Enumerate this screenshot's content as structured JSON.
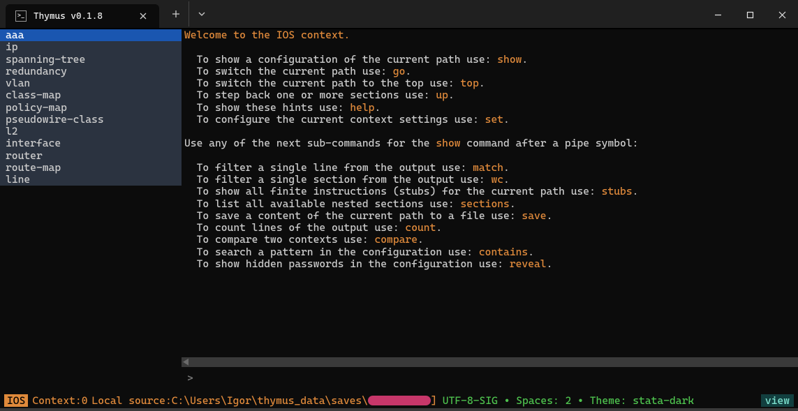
{
  "window": {
    "tab_title": "Thymus v0.1.8"
  },
  "sidebar": {
    "items": [
      "aaa",
      "ip",
      "spanning-tree",
      "redundancy",
      "vlan",
      "class-map",
      "policy-map",
      "pseudowire-class",
      "l2",
      "interface",
      "router",
      "route-map",
      "line"
    ],
    "selected_index": 0
  },
  "help": {
    "welcome": "Welcome to the IOS context.",
    "lines": [
      {
        "text": "  To show a configuration of the current path use: ",
        "kw": "show",
        "tail": "."
      },
      {
        "text": "  To switch the current path use: ",
        "kw": "go",
        "tail": "."
      },
      {
        "text": "  To switch the current path to the top use: ",
        "kw": "top",
        "tail": "."
      },
      {
        "text": "  To step back one or more sections use: ",
        "kw": "up",
        "tail": "."
      },
      {
        "text": "  To show these hints use: ",
        "kw": "help",
        "tail": "."
      },
      {
        "text": "  To configure the current context settings use: ",
        "kw": "set",
        "tail": "."
      }
    ],
    "mid": {
      "pre": "Use any of the next sub-commands for the ",
      "kw": "show",
      "post": " command after a pipe symbol:"
    },
    "sub_lines": [
      {
        "text": "  To filter a single line from the output use: ",
        "kw": "match",
        "tail": "."
      },
      {
        "text": "  To filter a single section from the output use: ",
        "kw": "wc",
        "tail": "."
      },
      {
        "text": "  To show all finite instructions (stubs) for the current path use: ",
        "kw": "stubs",
        "tail": "."
      },
      {
        "text": "  To list all available nested sections use: ",
        "kw": "sections",
        "tail": "."
      },
      {
        "text": "  To save a content of the current path to a file use: ",
        "kw": "save",
        "tail": "."
      },
      {
        "text": "  To count lines of the output use: ",
        "kw": "count",
        "tail": "."
      },
      {
        "text": "  To compare two contexts use: ",
        "kw": "compare",
        "tail": "."
      },
      {
        "text": "  To search a pattern in the configuration use: ",
        "kw": "contains",
        "tail": "."
      },
      {
        "text": "  To show hidden passwords in the configuration use: ",
        "kw": "reveal",
        "tail": "."
      }
    ]
  },
  "prompt": {
    "caret": ">"
  },
  "status": {
    "badge": "IOS",
    "context_label": " Context: ",
    "context_val": "0",
    "source_label": "  Local source: ",
    "path_prefix": "C:\\Users\\Igor\\thymus_data\\saves\\",
    "path_suffix_bracket": "]",
    "encoding_line": " UTF-8-SIG • Spaces: 2 • Theme: stata-dark ",
    "view": "view"
  }
}
